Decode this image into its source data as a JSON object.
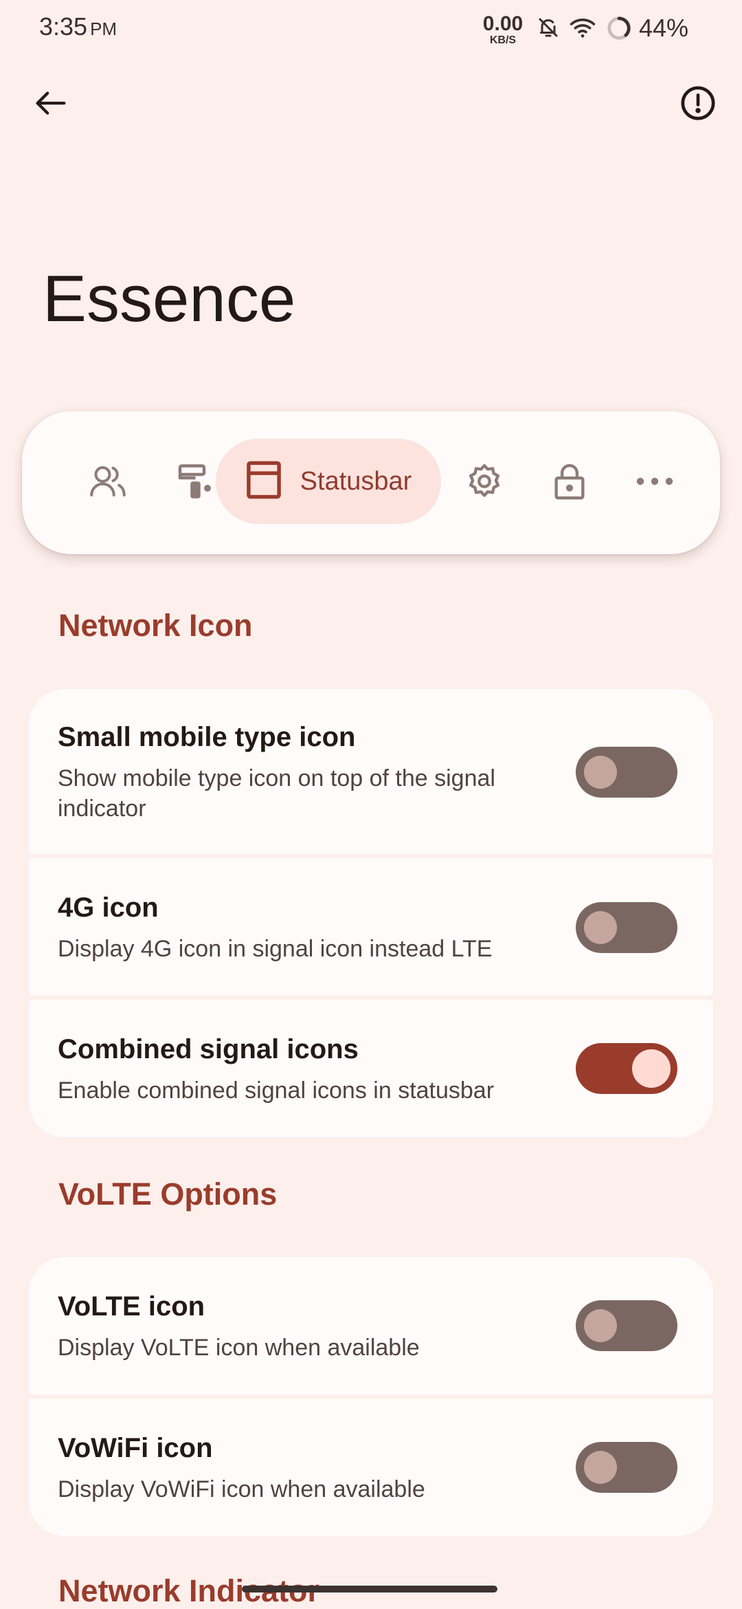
{
  "status_bar": {
    "time": "3:35",
    "ampm": "PM",
    "net_speed_value": "0.00",
    "net_speed_unit": "KB/S",
    "battery": "44%",
    "icons": [
      "alarm-off-icon",
      "wifi-icon",
      "battery-ring-icon"
    ]
  },
  "app_bar": {
    "back_icon": "arrow-back-icon",
    "info_icon": "exclamation-circle-icon"
  },
  "page_title": "Essence",
  "tabs": [
    {
      "icon": "users-icon",
      "label": "",
      "active": false
    },
    {
      "icon": "paint-roller-icon",
      "label": "",
      "active": false
    },
    {
      "icon": "statusbar-icon",
      "label": "Statusbar",
      "active": true
    },
    {
      "icon": "gear-icon",
      "label": "",
      "active": false
    },
    {
      "icon": "lock-icon",
      "label": "",
      "active": false
    },
    {
      "icon": "more-horizontal-icon",
      "label": "",
      "active": false
    }
  ],
  "sections": {
    "network_icon": {
      "header": "Network Icon",
      "items": [
        {
          "title": "Small mobile type icon",
          "desc": "Show mobile type icon on top of the signal indicator",
          "enabled": false
        },
        {
          "title": "4G icon",
          "desc": "Display 4G icon in signal icon instead LTE",
          "enabled": false
        },
        {
          "title": "Combined signal icons",
          "desc": "Enable combined signal icons in statusbar",
          "enabled": true
        }
      ]
    },
    "volte_options": {
      "header": "VoLTE Options",
      "items": [
        {
          "title": "VoLTE icon",
          "desc": "Display VoLTE icon when available",
          "enabled": false
        },
        {
          "title": "VoWiFi icon",
          "desc": "Display VoWiFi icon when available",
          "enabled": false
        }
      ]
    },
    "network_indicator": {
      "header": "Network Indicator"
    }
  },
  "colors": {
    "background": "#FCEFEC",
    "surface": "#FFFBFA",
    "accent": "#9A3C2C",
    "tab_active_bg": "#FCE3DE",
    "switch_off_track": "#7B6761",
    "switch_off_thumb": "#C4A69F",
    "switch_on_thumb": "#FFDAD3"
  }
}
